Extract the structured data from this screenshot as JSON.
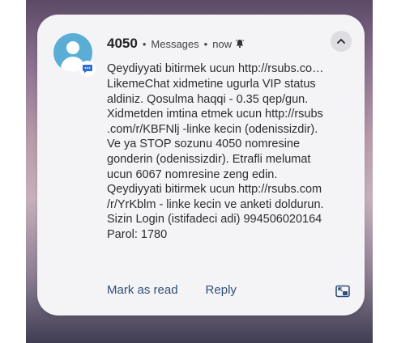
{
  "notification": {
    "sender": "4050",
    "app_name": "Messages",
    "time": "now",
    "separator": "•",
    "title_line": "Qeydiyyati bitirmek ucun http://rsubs.co…",
    "body": "LikemeChat xidmetine ugurla VIP status\naldiniz. Qosulma haqqi - 0.35 qep/gun.\nXidmetden imtina etmek ucun http://rsubs\n.com/r/KBFNlj -linke kecin (odenissizdir).\nVe ya STOP sozunu 4050 nomresine\ngonderin (odenissizdir). Etrafli melumat\nucun 6067 nomresine zeng edin.\nQeydiyyati bitirmek ucun http://rsubs.com\n/r/YrKblm - linke kecin ve anketi doldurun.\nSizin Login (istifadeci adi) 994506020164\nParol: 1780",
    "actions": {
      "mark_as_read": "Mark as read",
      "reply": "Reply"
    },
    "icons": {
      "avatar": "contact-avatar-icon",
      "app_badge": "messages-app-icon",
      "alert": "bell-icon",
      "collapse": "chevron-up-icon",
      "expand": "open-in-window-icon"
    },
    "colors": {
      "avatar_bg": "#5aaed6",
      "action_text": "#2f4f78",
      "card_bg": "#f4f4f6"
    }
  }
}
